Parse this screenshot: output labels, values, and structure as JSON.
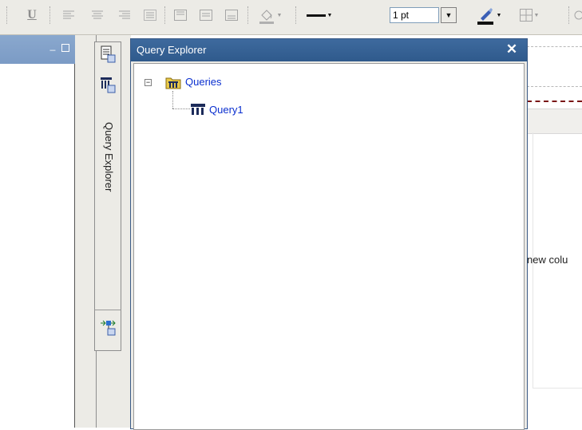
{
  "toolbar": {
    "underline_label": "U",
    "line_width_value": "1 pt",
    "icons": [
      "underline-icon",
      "align-left-icon",
      "align-center-icon",
      "align-right-icon",
      "justify-icon",
      "valign-top-icon",
      "valign-middle-icon",
      "valign-bottom-icon",
      "fill-color-icon",
      "line-style-icon",
      "line-color-icon",
      "borders-icon"
    ]
  },
  "side_tabs": {
    "query_explorer_label": "Query Explorer",
    "icons": [
      "page-explorer-icon",
      "query-explorer-icon",
      "condition-explorer-icon"
    ]
  },
  "query_explorer": {
    "title": "Query Explorer",
    "close_glyph": "✕",
    "tree": {
      "root": {
        "label": "Queries",
        "expander": "−",
        "icon": "queries-folder-icon"
      },
      "children": [
        {
          "label": "Query1",
          "icon": "query-icon"
        }
      ]
    }
  },
  "report": {
    "column_text": "new colu"
  },
  "colors": {
    "title_bar": "#2f5a8c",
    "tree_link": "#0a2fcf",
    "left_header": "#7b9bc5",
    "red_dash": "#7a1515"
  }
}
